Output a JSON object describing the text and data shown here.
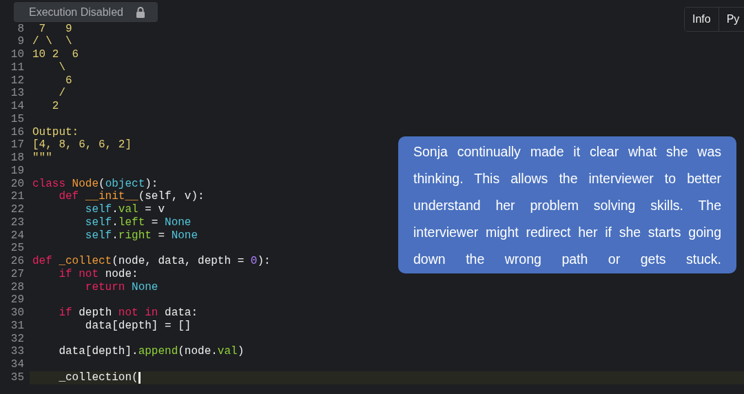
{
  "editor": {
    "lines": [
      {
        "number": "8",
        "tokens": [
          {
            "kind": "str",
            "text": " 7   9"
          }
        ]
      },
      {
        "number": "9",
        "tokens": [
          {
            "kind": "str",
            "text": "/ \\  \\"
          }
        ]
      },
      {
        "number": "10",
        "tokens": [
          {
            "kind": "str",
            "text": "10 2  6"
          }
        ]
      },
      {
        "number": "11",
        "tokens": [
          {
            "kind": "str",
            "text": "    \\"
          }
        ]
      },
      {
        "number": "12",
        "tokens": [
          {
            "kind": "str",
            "text": "     6"
          }
        ]
      },
      {
        "number": "13",
        "tokens": [
          {
            "kind": "str",
            "text": "    /"
          }
        ]
      },
      {
        "number": "14",
        "tokens": [
          {
            "kind": "str",
            "text": "   2"
          }
        ]
      },
      {
        "number": "15"
      },
      {
        "number": "16",
        "tokens": [
          {
            "kind": "str",
            "text": "Output:"
          }
        ]
      },
      {
        "number": "17",
        "tokens": [
          {
            "kind": "str",
            "text": "[4, 8, 6, 6, 2]"
          }
        ]
      },
      {
        "number": "18",
        "tokens": [
          {
            "kind": "str",
            "text": "\"\"\""
          }
        ]
      },
      {
        "number": "19"
      },
      {
        "number": "20",
        "tokens": [
          {
            "kind": "kw",
            "text": "class "
          },
          {
            "kind": "name",
            "text": "Node"
          },
          {
            "kind": "plain",
            "text": "("
          },
          {
            "kind": "builtin",
            "text": "object"
          },
          {
            "kind": "plain",
            "text": "):"
          }
        ]
      },
      {
        "number": "21",
        "tokens": [
          {
            "kind": "kw",
            "text": "    def "
          },
          {
            "kind": "name",
            "text": "__init__"
          },
          {
            "kind": "plain",
            "text": "(self, v):"
          }
        ]
      },
      {
        "number": "22",
        "tokens": [
          {
            "kind": "builtin",
            "text": "        self"
          },
          {
            "kind": "plain",
            "text": "."
          },
          {
            "kind": "attr",
            "text": "val"
          },
          {
            "kind": "plain",
            "text": " = v"
          }
        ]
      },
      {
        "number": "23",
        "tokens": [
          {
            "kind": "builtin",
            "text": "        self"
          },
          {
            "kind": "plain",
            "text": "."
          },
          {
            "kind": "attr",
            "text": "left"
          },
          {
            "kind": "plain",
            "text": " = "
          },
          {
            "kind": "builtin",
            "text": "None"
          }
        ]
      },
      {
        "number": "24",
        "tokens": [
          {
            "kind": "builtin",
            "text": "        self"
          },
          {
            "kind": "plain",
            "text": "."
          },
          {
            "kind": "attr",
            "text": "right"
          },
          {
            "kind": "plain",
            "text": " = "
          },
          {
            "kind": "builtin",
            "text": "None"
          }
        ]
      },
      {
        "number": "25"
      },
      {
        "number": "26",
        "tokens": [
          {
            "kind": "kw",
            "text": "def "
          },
          {
            "kind": "name",
            "text": "_collect"
          },
          {
            "kind": "plain",
            "text": "(node, data, depth = "
          },
          {
            "kind": "num",
            "text": "0"
          },
          {
            "kind": "plain",
            "text": "):"
          }
        ]
      },
      {
        "number": "27",
        "tokens": [
          {
            "kind": "kw",
            "text": "    if not "
          },
          {
            "kind": "plain",
            "text": "node:"
          }
        ]
      },
      {
        "number": "28",
        "tokens": [
          {
            "kind": "kw",
            "text": "        return "
          },
          {
            "kind": "builtin",
            "text": "None"
          }
        ]
      },
      {
        "number": "29"
      },
      {
        "number": "30",
        "tokens": [
          {
            "kind": "kw",
            "text": "    if "
          },
          {
            "kind": "plain",
            "text": "depth "
          },
          {
            "kind": "kw",
            "text": "not in "
          },
          {
            "kind": "plain",
            "text": "data:"
          }
        ]
      },
      {
        "number": "31",
        "tokens": [
          {
            "kind": "plain",
            "text": "        data[depth] = []"
          }
        ]
      },
      {
        "number": "32"
      },
      {
        "number": "33",
        "tokens": [
          {
            "kind": "plain",
            "text": "    data[depth]."
          },
          {
            "kind": "attr",
            "text": "append"
          },
          {
            "kind": "plain",
            "text": "(node."
          },
          {
            "kind": "attr",
            "text": "val"
          },
          {
            "kind": "plain",
            "text": ")"
          }
        ]
      },
      {
        "number": "34"
      },
      {
        "number": "35",
        "current": true,
        "tokens": [
          {
            "kind": "plain",
            "text": "    _collection("
          }
        ]
      }
    ]
  },
  "execution_notice": {
    "text": "Execution Disabled"
  },
  "tabs": [
    {
      "label": "Info",
      "selected": false
    },
    {
      "label": "Py",
      "selected": false
    }
  ],
  "caption": {
    "text": "Sonja continually made it clear what she was thinking. This allows the interviewer to better understand her problem solving skills. The interviewer might redirect her if she starts going down the wrong path or gets stuck."
  }
}
